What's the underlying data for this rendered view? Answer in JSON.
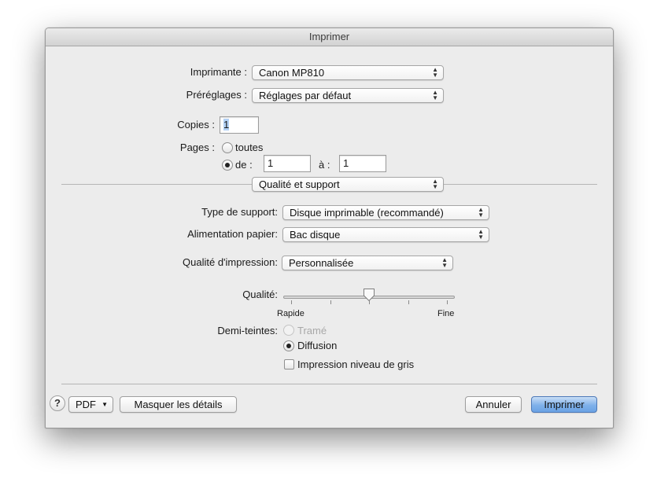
{
  "window": {
    "title": "Imprimer"
  },
  "printer": {
    "label": "Imprimante :",
    "value": "Canon MP810"
  },
  "presets": {
    "label": "Préréglages :",
    "value": "Réglages par défaut"
  },
  "copies": {
    "label": "Copies :",
    "value": "1"
  },
  "pages": {
    "label": "Pages :",
    "all_label": "toutes",
    "all_selected": false,
    "from_label": "de :",
    "from_selected": true,
    "from_value": "1",
    "to_label": "à :",
    "to_value": "1"
  },
  "section": {
    "value": "Qualité et support"
  },
  "media_type": {
    "label": "Type de support:",
    "value": "Disque imprimable (recommandé)"
  },
  "paper_source": {
    "label": "Alimentation papier:",
    "value": "Bac disque"
  },
  "print_quality": {
    "label": "Qualité d'impression:",
    "value": "Personnalisée"
  },
  "quality_slider": {
    "label": "Qualité:",
    "min_label": "Rapide",
    "max_label": "Fine",
    "ticks": 5,
    "value_fraction": 0.5
  },
  "halftone": {
    "label": "Demi-teintes:",
    "option1": "Tramé",
    "option1_enabled": false,
    "option2": "Diffusion",
    "option2_selected": true
  },
  "grayscale": {
    "label": "Impression niveau de gris",
    "checked": false
  },
  "footer": {
    "help": "?",
    "pdf": "PDF",
    "pdf_arrow": "▼",
    "hide_details": "Masquer les détails",
    "cancel": "Annuler",
    "print": "Imprimer"
  }
}
